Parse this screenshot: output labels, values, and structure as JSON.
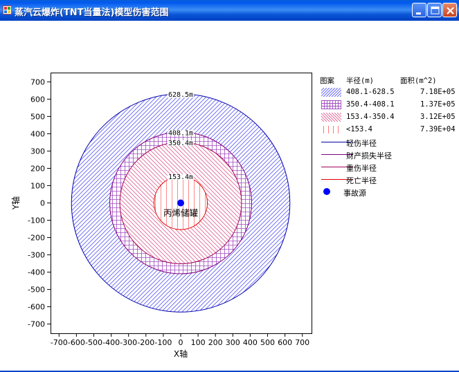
{
  "window": {
    "title": "蒸汽云爆炸(TNT当量法)模型伤害范围"
  },
  "chart_data": {
    "type": "other",
    "subtype": "concentric damage-radius circles",
    "xlabel": "X轴",
    "ylabel": "Y轴",
    "xlim": [
      -750,
      750
    ],
    "ylim": [
      -750,
      750
    ],
    "xticks": [
      -700,
      -600,
      -500,
      -400,
      -300,
      -200,
      -100,
      0,
      100,
      200,
      300,
      400,
      500,
      600,
      700
    ],
    "yticks": [
      700,
      600,
      500,
      400,
      300,
      200,
      100,
      0,
      -100,
      -200,
      -300,
      -400,
      -500,
      -600,
      -700
    ],
    "source": {
      "x": 0,
      "y": 0,
      "label": "丙烯储罐",
      "color": "#0000ff"
    },
    "circles": [
      {
        "radius": 628.5,
        "label": "628.5m",
        "color": "#0000aa",
        "hatch": "forward-diagonal",
        "hatch_color": "#5a5af5"
      },
      {
        "radius": 408.1,
        "label": "408.1m",
        "color": "#800080",
        "hatch": "grid",
        "hatch_color": "#a04ac0"
      },
      {
        "radius": 350.4,
        "label": "350.4m",
        "color": "#a0005a",
        "hatch": "backward-diagonal",
        "hatch_color": "#e06090"
      },
      {
        "radius": 153.4,
        "label": "153.4m",
        "color": "#e00000",
        "hatch": "vertical",
        "hatch_color": "#ff6a6a"
      }
    ],
    "legend": {
      "headers": [
        "图案",
        "半径(m)",
        "面积(m^2)"
      ],
      "areas": [
        {
          "range": "408.1-628.5",
          "area": "7.18E+05",
          "hatch": "forward-diagonal",
          "color": "#5a5af5"
        },
        {
          "range": "350.4-408.1",
          "area": "1.37E+05",
          "hatch": "grid",
          "color": "#a04ac0"
        },
        {
          "range": "153.4-350.4",
          "area": "3.12E+05",
          "hatch": "backward-diagonal",
          "color": "#e06090"
        },
        {
          "range": "<153.4",
          "area": "7.39E+04",
          "hatch": "vertical",
          "color": "#ff6a6a"
        }
      ],
      "lines": [
        {
          "label": "轻伤半径",
          "color": "#0000aa"
        },
        {
          "label": "财产损失半径",
          "color": "#800080"
        },
        {
          "label": "重伤半径",
          "color": "#a0005a"
        },
        {
          "label": "死亡半径",
          "color": "#e00000"
        }
      ],
      "source_label": "事故源",
      "source_color": "#0000ff"
    }
  }
}
